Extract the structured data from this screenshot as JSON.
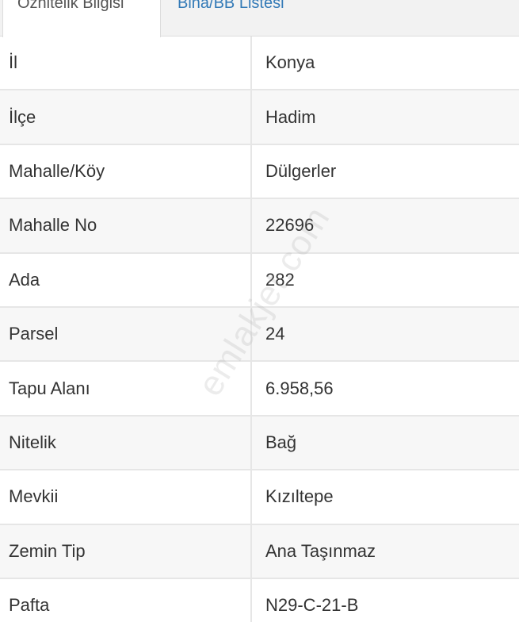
{
  "tabs": [
    {
      "label": "Öznitelik Bilgisi",
      "active": true
    },
    {
      "label": "Bina/BB Listesi",
      "active": false
    }
  ],
  "rows": [
    {
      "label": "İl",
      "value": "Konya"
    },
    {
      "label": "İlçe",
      "value": "Hadim"
    },
    {
      "label": "Mahalle/Köy",
      "value": "Dülgerler"
    },
    {
      "label": "Mahalle No",
      "value": "22696"
    },
    {
      "label": "Ada",
      "value": "282"
    },
    {
      "label": "Parsel",
      "value": "24"
    },
    {
      "label": "Tapu Alanı",
      "value": "6.958,56"
    },
    {
      "label": "Nitelik",
      "value": "Bağ"
    },
    {
      "label": "Mevkii",
      "value": "Kızıltepe"
    },
    {
      "label": "Zemin Tip",
      "value": "Ana Taşınmaz"
    },
    {
      "label": "Pafta",
      "value": "N29-C-21-B"
    }
  ],
  "watermark": "emlakjet.com",
  "colors": {
    "tab_link": "#337ab7",
    "text": "#333333",
    "row_alt": "#f7f7f7",
    "border": "#e6e6e6"
  }
}
